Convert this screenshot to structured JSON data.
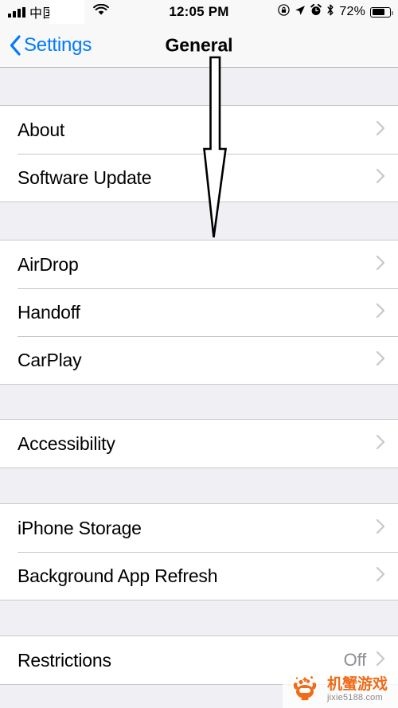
{
  "status_bar": {
    "carrier": "中国",
    "time": "12:05 PM",
    "battery_percent": "72%",
    "battery_level": 72,
    "icons": [
      "signal-bars-icon",
      "wifi-icon",
      "rotation-lock-icon",
      "location-arrow-icon",
      "alarm-clock-icon",
      "bluetooth-icon",
      "battery-icon"
    ]
  },
  "nav": {
    "back_label": "Settings",
    "title": "General",
    "back_tint": "#007aff"
  },
  "sections": [
    {
      "rows": [
        {
          "label": "About",
          "value": ""
        },
        {
          "label": "Software Update",
          "value": ""
        }
      ]
    },
    {
      "rows": [
        {
          "label": "AirDrop",
          "value": ""
        },
        {
          "label": "Handoff",
          "value": ""
        },
        {
          "label": "CarPlay",
          "value": ""
        }
      ]
    },
    {
      "rows": [
        {
          "label": "Accessibility",
          "value": ""
        }
      ]
    },
    {
      "rows": [
        {
          "label": "iPhone Storage",
          "value": ""
        },
        {
          "label": "Background App Refresh",
          "value": ""
        }
      ]
    },
    {
      "rows": [
        {
          "label": "Restrictions",
          "value": "Off"
        }
      ]
    }
  ],
  "annotation": {
    "type": "down-arrow",
    "description": "white outlined arrow pointing down"
  },
  "watermark": {
    "site_name": "机蟹游戏",
    "url": "jixie5188.com",
    "color": "#ef6c1a"
  },
  "colors": {
    "group_background": "#ffffff",
    "page_background": "#efeff4",
    "separator": "#c8c7cc",
    "secondary_text": "#8e8e93",
    "accent": "#007aff"
  }
}
